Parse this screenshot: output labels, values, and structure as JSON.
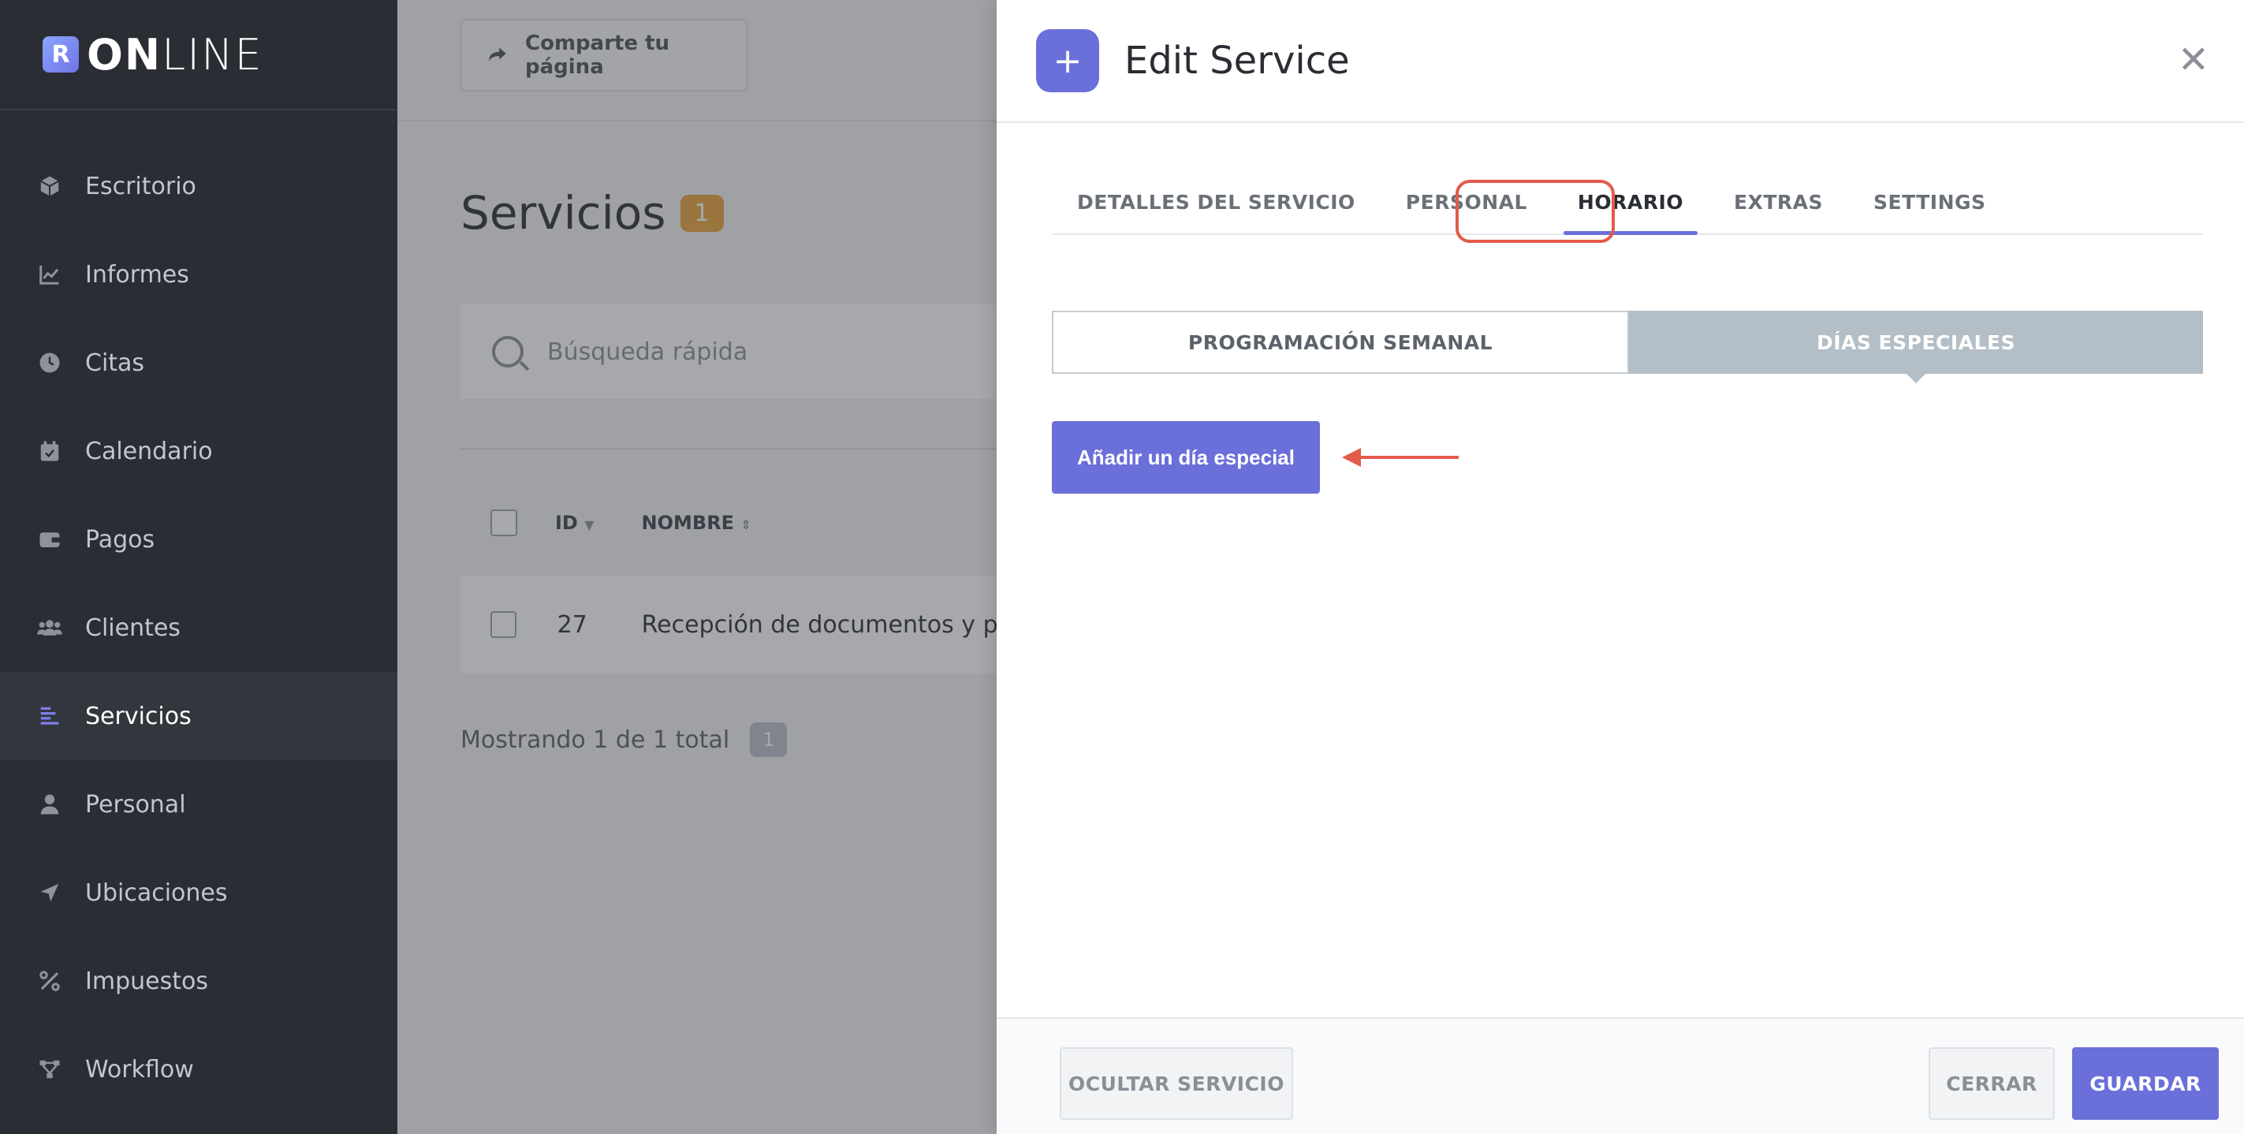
{
  "brand": {
    "logo_letter": "R",
    "bold": "ON",
    "light": "LINE"
  },
  "sidebar": {
    "items": [
      {
        "label": "Escritorio",
        "icon": "cube-icon"
      },
      {
        "label": "Informes",
        "icon": "chart-line-icon"
      },
      {
        "label": "Citas",
        "icon": "clock-icon"
      },
      {
        "label": "Calendario",
        "icon": "calendar-icon"
      },
      {
        "label": "Pagos",
        "icon": "wallet-icon"
      },
      {
        "label": "Clientes",
        "icon": "users-icon"
      },
      {
        "label": "Servicios",
        "icon": "list-icon",
        "active": true
      },
      {
        "label": "Personal",
        "icon": "user-icon"
      },
      {
        "label": "Ubicaciones",
        "icon": "location-arrow-icon"
      },
      {
        "label": "Impuestos",
        "icon": "percent-icon"
      },
      {
        "label": "Workflow",
        "icon": "workflow-icon"
      }
    ]
  },
  "main": {
    "share_label": "Comparte tu página",
    "title": "Servicios",
    "count": "1",
    "search_placeholder": "Búsqueda rápida",
    "table": {
      "headers": [
        "ID",
        "NOMBRE"
      ],
      "rows": [
        {
          "id": "27",
          "name": "Recepción de documentos y pa"
        }
      ]
    },
    "footer_text": "Mostrando 1 de 1 total",
    "footer_badge": "1"
  },
  "drawer": {
    "title": "Edit Service",
    "tabs": [
      "DETALLES DEL SERVICIO",
      "PERSONAL",
      "HORARIO",
      "EXTRAS",
      "SETTINGS"
    ],
    "active_tab": "HORARIO",
    "segments": [
      "PROGRAMACIÓN SEMANAL",
      "DÍAS ESPECIALES"
    ],
    "active_segment": "DÍAS ESPECIALES",
    "add_button": "Añadir un día especial",
    "footer": {
      "hide_label": "OCULTAR SERVICIO",
      "close_label": "CERRAR",
      "save_label": "GUARDAR"
    }
  },
  "colors": {
    "accent": "#6b6fd9",
    "sidebar_bg": "#2a2d33",
    "highlight": "#e35b4b",
    "badge": "#e8a33a"
  }
}
